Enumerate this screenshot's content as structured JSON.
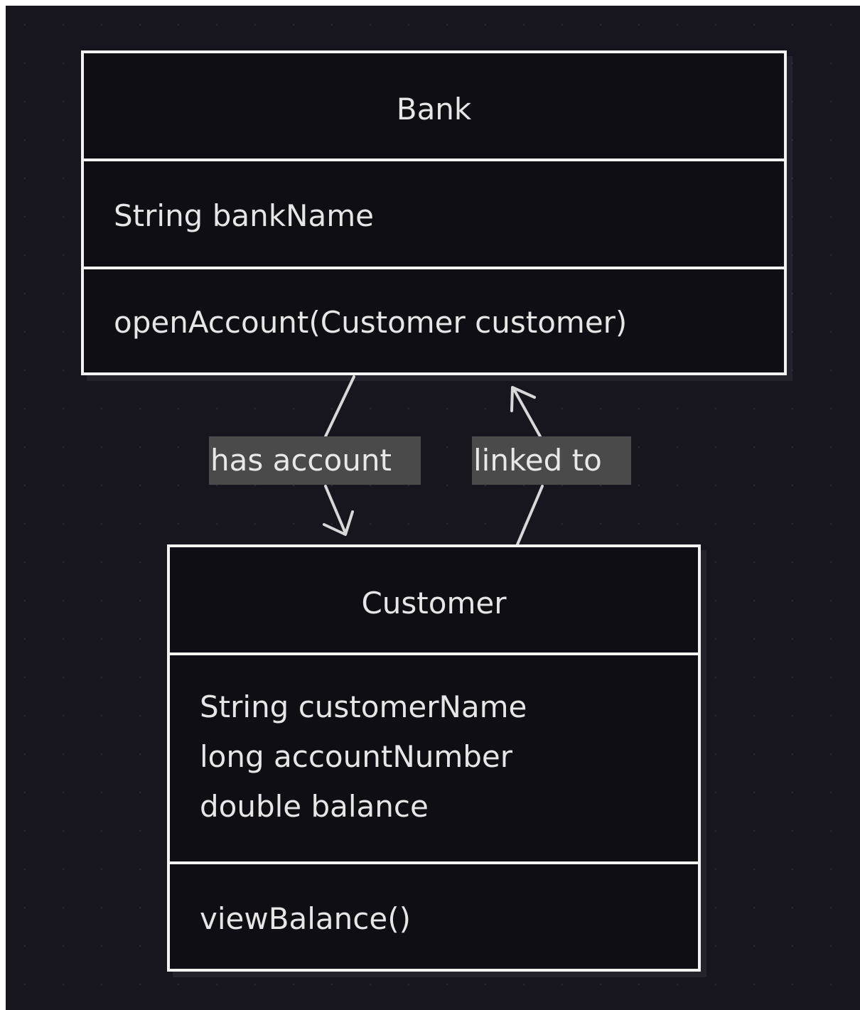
{
  "diagram": {
    "classes": {
      "bank": {
        "name": "Bank",
        "attributes": [
          "String bankName"
        ],
        "methods": [
          "openAccount(Customer customer)"
        ]
      },
      "customer": {
        "name": "Customer",
        "attributes": [
          "String customerName",
          "long accountNumber",
          "double balance"
        ],
        "methods": [
          "viewBalance()"
        ]
      }
    },
    "relationships": [
      {
        "from": "Bank",
        "to": "Customer",
        "label": "has account"
      },
      {
        "from": "Customer",
        "to": "Bank",
        "label": "linked to"
      }
    ]
  }
}
